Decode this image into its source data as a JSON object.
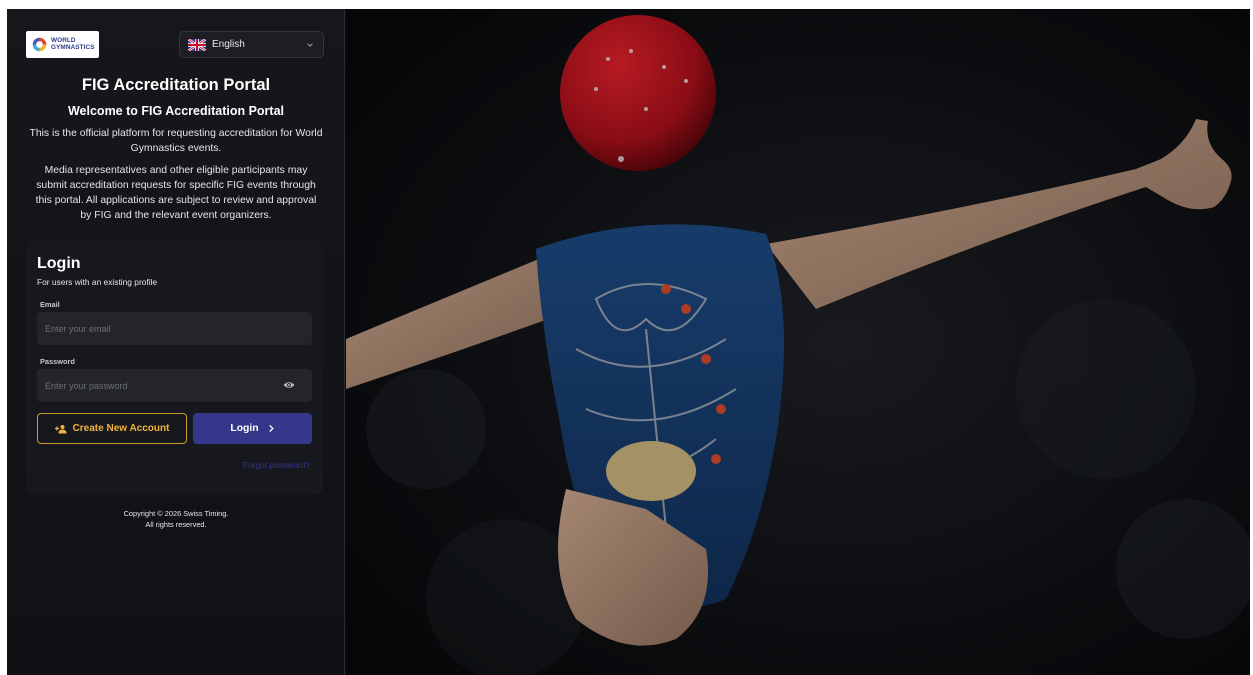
{
  "brand": {
    "logo_line1": "WORLD",
    "logo_line2": "GYMNASTICS"
  },
  "language_selector": {
    "selected": "English",
    "flag_icon": "uk-flag-icon"
  },
  "header": {
    "title": "FIG Accreditation Portal",
    "subtitle": "Welcome to FIG Accreditation Portal",
    "description_1": "This is the official platform for requesting accreditation for World Gymnastics events.",
    "description_2": "Media representatives and other eligible participants may submit accreditation requests for specific FIG events through this portal. All applications are subject to review and approval by FIG and the relevant event organizers."
  },
  "login": {
    "heading": "Login",
    "subheading": "For users with an existing profile",
    "email_label": "Email",
    "email_placeholder": "Enter your email",
    "email_value": "",
    "password_label": "Password",
    "password_placeholder": "Enter your password",
    "password_value": "",
    "create_account_label": "Create New Account",
    "login_label": "Login",
    "forgot_password_label": "Forgot password?"
  },
  "footer": {
    "copyright_line1": "Copyright © 2026 Swiss Timing.",
    "copyright_line2": "All rights reserved."
  },
  "colors": {
    "accent_gold": "#f0b43a",
    "login_button": "#34378a",
    "panel_bg": "#16171b"
  },
  "icons": [
    "world-gymnastics-logo",
    "uk-flag-icon",
    "chevron-down-icon",
    "eye-icon",
    "add-user-icon",
    "chevron-right-icon"
  ]
}
